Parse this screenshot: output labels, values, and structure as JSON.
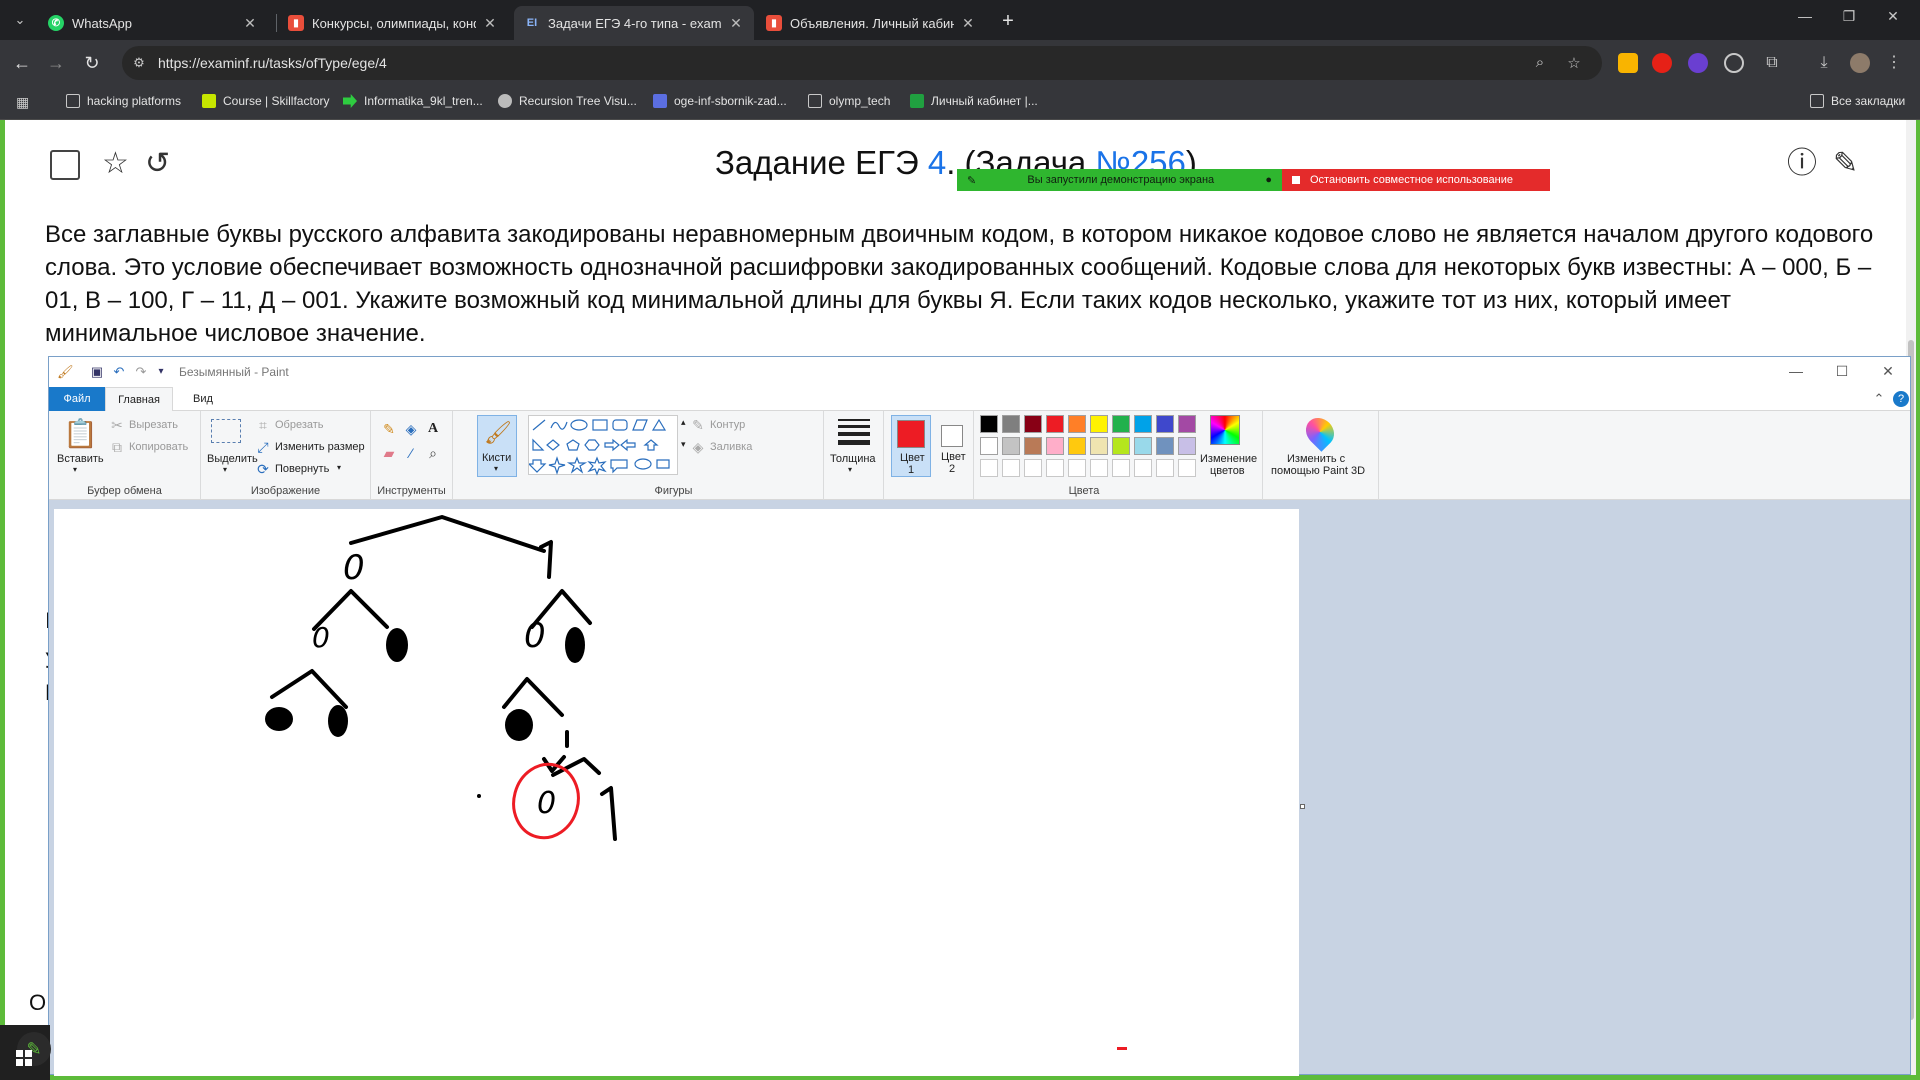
{
  "browser": {
    "tabs": [
      {
        "label": "WhatsApp",
        "icon": "whatsapp-icon",
        "color": "#25d366",
        "active": false
      },
      {
        "label": "Конкурсы, олимпиады, конфе",
        "icon": "chart-favicon",
        "color": "#e94e3b",
        "active": false
      },
      {
        "label": "Задачи ЕГЭ 4-го типа - examin",
        "icon": "examinf-favicon",
        "color": "#5b8def",
        "active": true
      },
      {
        "label": "Объявления. Личный кабинет",
        "icon": "chart-favicon",
        "color": "#e94e3b",
        "active": false
      }
    ],
    "url": "https://examinf.ru/tasks/ofType/ege/4",
    "bookmarks": [
      {
        "label": "hacking platforms",
        "icon": "folder-icon"
      },
      {
        "label": "Course | Skillfactory",
        "icon": "skillfactory-icon"
      },
      {
        "label": "Informatika_9kl_tren...",
        "icon": "arrow-favicon"
      },
      {
        "label": "Recursion Tree Visu...",
        "icon": "tree-favicon"
      },
      {
        "label": "oge-inf-sbornik-zad...",
        "icon": "doc-favicon"
      },
      {
        "label": "olymp_tech",
        "icon": "folder-icon"
      },
      {
        "label": "Личный кабинет |...",
        "icon": "grid-favicon"
      }
    ],
    "all_bookmarks": "Все закладки"
  },
  "task": {
    "title_prefix": "Задание ЕГЭ ",
    "title_link": "4",
    "title_middle": ". (Задача ",
    "title_num": "№256",
    "title_suffix": ")",
    "text": "Все заглавные буквы русского алфавита закодированы неравномерным двоичным кодом, в котором никакое кодовое слово не является началом другого кодового слова. Это условие обеспечивает возможность однозначной расшифровки закодированных сообщений. Кодовые слова для некоторых букв известны: А – 000, Б – 01, В – 100, Г – 11, Д – 001. Укажите возможный код минимальной длины для буквы Я. Если таких кодов несколько, укажите тот из них, который имеет минимальное числовое значение.",
    "frag_o": "О",
    "frag_i": "I",
    "frag_y": "У",
    "frag_r": "Г"
  },
  "share_bar": {
    "started": "Вы запустили демонстрацию экрана",
    "stop": "Остановить совместное использование"
  },
  "paint": {
    "title": "Безымянный - Paint",
    "tabs": {
      "file": "Файл",
      "home": "Главная",
      "view": "Вид"
    },
    "clipboard": {
      "paste": "Вставить",
      "cut": "Вырезать",
      "copy": "Копировать",
      "group": "Буфер обмена"
    },
    "image": {
      "select": "Выделить",
      "crop": "Обрезать",
      "resize": "Изменить размер",
      "rotate": "Повернуть",
      "group": "Изображение"
    },
    "tools": {
      "group": "Инструменты"
    },
    "brushes": "Кисти",
    "shapes": {
      "outline": "Контур",
      "fill": "Заливка",
      "group": "Фигуры"
    },
    "size": "Толщина",
    "color1": {
      "line1": "Цвет",
      "line2": "1"
    },
    "color2": {
      "line1": "Цвет",
      "line2": "2"
    },
    "edit_colors": {
      "line1": "Изменение",
      "line2": "цветов"
    },
    "paint3d": {
      "line1": "Изменить с",
      "line2": "помощью Paint 3D"
    },
    "colors_group": "Цвета",
    "active_color": "#ed1c24",
    "palette": [
      "#000000",
      "#7f7f7f",
      "#880015",
      "#ed1c24",
      "#ff7f27",
      "#fff200",
      "#22b14c",
      "#00a2e8",
      "#3f48cc",
      "#a349a4",
      "#ffffff",
      "#c3c3c3",
      "#b97a57",
      "#ffaec9",
      "#ffc90e",
      "#efe4b0",
      "#b5e61d",
      "#99d9ea",
      "#7092be",
      "#c8bfe7"
    ],
    "drawing": {
      "labels": [
        "0",
        "1",
        "0",
        "0",
        "1",
        "0"
      ]
    }
  }
}
